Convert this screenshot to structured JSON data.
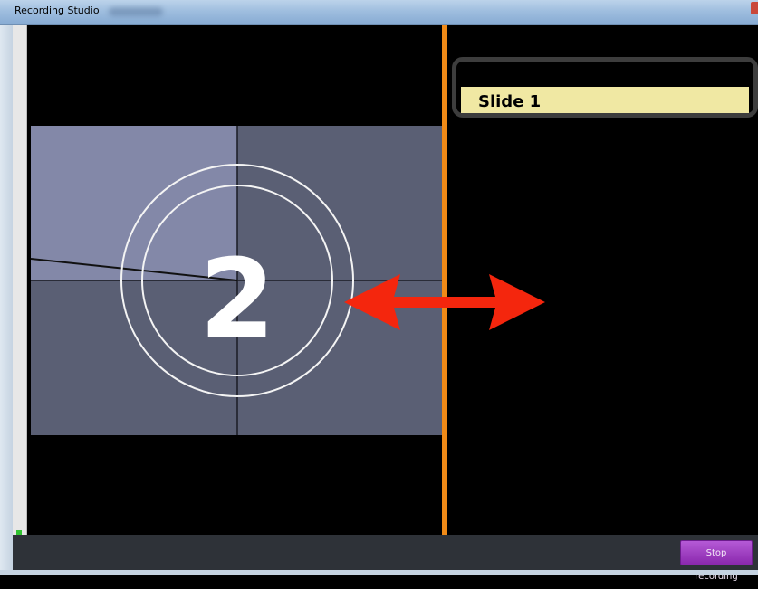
{
  "window": {
    "title": "Recording Studio"
  },
  "countdown": {
    "number": "2"
  },
  "slide_panel": {
    "slide_title": "Slide 1"
  },
  "toolbar": {
    "stop_label": "Stop recording"
  },
  "colors": {
    "accent_bar": "#f08a17",
    "slide_title_bg": "#f0e8a3",
    "stop_button": "#9b3fc2",
    "arrow": "#f4260d"
  },
  "icons": [
    "double-headed-arrow-icon"
  ]
}
